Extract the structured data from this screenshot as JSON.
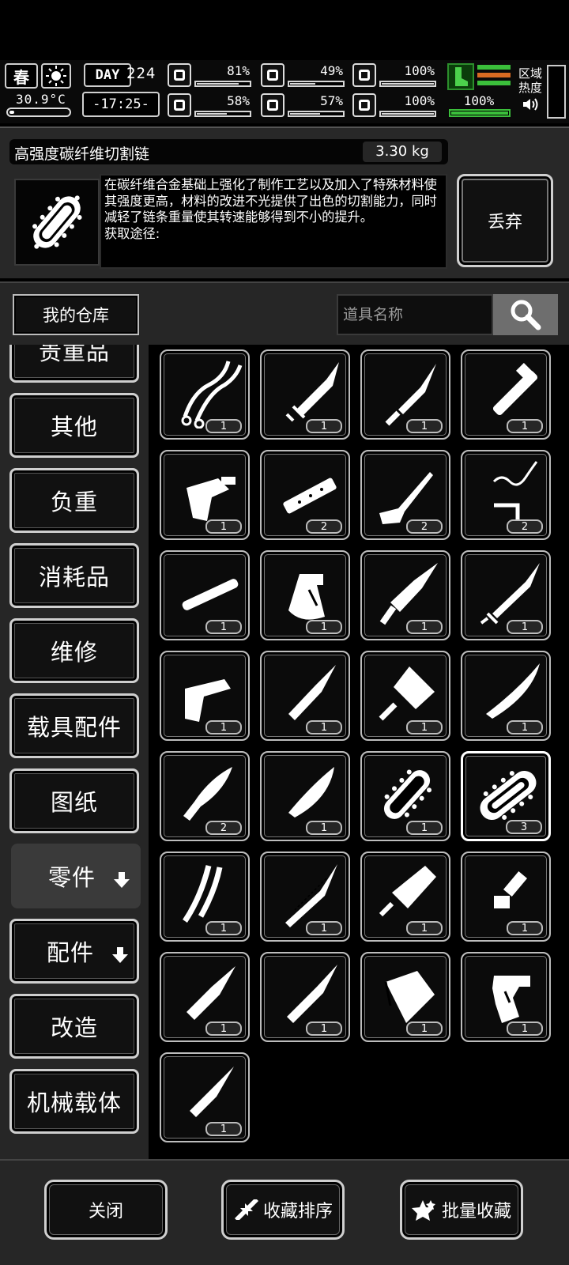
{
  "status": {
    "season": "春",
    "weather_icon": "sun-icon",
    "temperature": "30.9°C",
    "day_label": "DAY",
    "day_number": "224",
    "clock": "-17:25-",
    "stats": [
      {
        "name": "health",
        "icon": "medkit-icon",
        "value": "81%",
        "level": 0.81
      },
      {
        "name": "hunger",
        "icon": "stomach-icon",
        "value": "49%",
        "level": 0.49
      },
      {
        "name": "armor",
        "icon": "capsule-icon",
        "value": "100%",
        "level": 1.0
      },
      {
        "name": "mental",
        "icon": "brain-icon",
        "value": "58%",
        "level": 0.58
      },
      {
        "name": "thirst",
        "icon": "water-drop-icon",
        "value": "57%",
        "level": 0.57
      },
      {
        "name": "heart",
        "icon": "heart-icon",
        "value": "100%",
        "level": 1.0
      }
    ],
    "stamina_value": "100%",
    "stamina_level": 1.0,
    "region_heat_label_1": "区域",
    "region_heat_label_2": "热度"
  },
  "detail": {
    "name": "高强度碳纤维切割链",
    "weight": "3.30 kg",
    "description": "在碳纤维合金基础上强化了制作工艺以及加入了特殊材料使其强度更高，材料的改进不光提供了出色的切割能力，同时减轻了链条重量使其转速能够得到不小的提升。",
    "source": "获取途径:",
    "discard_label": "丢弃"
  },
  "warehouse": {
    "tab_label": "我的仓库",
    "search_placeholder": "道具名称"
  },
  "categories": [
    {
      "label": "贵重品"
    },
    {
      "label": "其他"
    },
    {
      "label": "负重"
    },
    {
      "label": "消耗品"
    },
    {
      "label": "维修"
    },
    {
      "label": "载具配件"
    },
    {
      "label": "图纸"
    },
    {
      "label": "零件",
      "expandable": true,
      "selected": true
    },
    {
      "label": "配件",
      "expandable": true
    },
    {
      "label": "改造"
    },
    {
      "label": "机械载体"
    }
  ],
  "items": [
    {
      "icon": "whip-cords-icon",
      "count": "1"
    },
    {
      "icon": "dagger-blade-icon",
      "count": "1"
    },
    {
      "icon": "spear-tip-icon",
      "count": "1"
    },
    {
      "icon": "gun-barrel-icon",
      "count": "1"
    },
    {
      "icon": "pistol-grip-icon",
      "count": "1"
    },
    {
      "icon": "rail-mount-icon",
      "count": "2"
    },
    {
      "icon": "rifle-icon",
      "count": "2"
    },
    {
      "icon": "wire-parts-icon",
      "count": "2"
    },
    {
      "icon": "tube-icon",
      "count": "1"
    },
    {
      "icon": "axe-head-icon",
      "count": "1"
    },
    {
      "icon": "ornate-spearhead-icon",
      "count": "1"
    },
    {
      "icon": "sword-blade-icon",
      "count": "1"
    },
    {
      "icon": "pistol-frame-icon",
      "count": "1"
    },
    {
      "icon": "jagged-blade-icon",
      "count": "1"
    },
    {
      "icon": "cleaver-icon",
      "count": "1"
    },
    {
      "icon": "machete-icon",
      "count": "1"
    },
    {
      "icon": "kris-blade-icon",
      "count": "2"
    },
    {
      "icon": "kukri-blade-icon",
      "count": "1"
    },
    {
      "icon": "chainsaw-chain-icon",
      "count": "1"
    },
    {
      "icon": "carbon-chainsaw-chain-icon",
      "count": "3",
      "selected": true
    },
    {
      "icon": "tangled-blades-icon",
      "count": "1"
    },
    {
      "icon": "serrated-sword-icon",
      "count": "1"
    },
    {
      "icon": "cracked-cleaver-icon",
      "count": "1"
    },
    {
      "icon": "trigger-part-icon",
      "count": "1"
    },
    {
      "icon": "spearhead-icon",
      "count": "1"
    },
    {
      "icon": "spearhead-long-icon",
      "count": "1"
    },
    {
      "icon": "axe-blade-icon",
      "count": "1"
    },
    {
      "icon": "handle-grip-icon",
      "count": "1"
    },
    {
      "icon": "short-spearhead-icon",
      "count": "1"
    }
  ],
  "bottom": {
    "close_label": "关闭",
    "sort_label": "收藏排序",
    "batch_label": "批量收藏"
  }
}
